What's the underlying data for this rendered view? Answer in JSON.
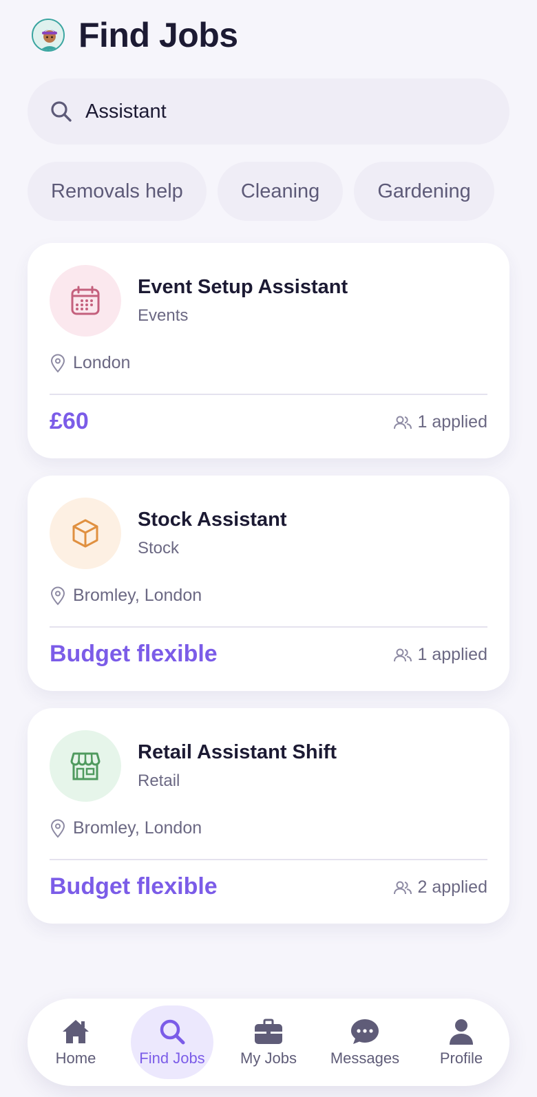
{
  "header": {
    "title": "Find Jobs",
    "avatar_icon": "avatar-icon"
  },
  "search": {
    "value": "Assistant",
    "icon": "search-icon"
  },
  "filters": {
    "chips": [
      "Removals help",
      "Cleaning",
      "Gardening"
    ]
  },
  "jobs": [
    {
      "title": "Event Setup Assistant",
      "category": "Events",
      "location": "London",
      "budget": "£60",
      "applied": "1 applied",
      "icon": "calendar-icon",
      "icon_color": "#c4607d",
      "icon_bg": "#fbe8ee"
    },
    {
      "title": "Stock Assistant",
      "category": "Stock",
      "location": "Bromley, London",
      "budget": "Budget flexible",
      "applied": "1 applied",
      "icon": "box-icon",
      "icon_color": "#e09040",
      "icon_bg": "#fdf0e3"
    },
    {
      "title": "Retail Assistant Shift",
      "category": "Retail",
      "location": "Bromley, London",
      "budget": "Budget flexible",
      "applied": "2 applied",
      "icon": "store-icon",
      "icon_color": "#4f9a5e",
      "icon_bg": "#e6f5ea"
    }
  ],
  "nav": {
    "items": [
      {
        "label": "Home",
        "icon": "home-icon",
        "active": false
      },
      {
        "label": "Find Jobs",
        "icon": "search-icon",
        "active": true
      },
      {
        "label": "My Jobs",
        "icon": "briefcase-icon",
        "active": false
      },
      {
        "label": "Messages",
        "icon": "chat-icon",
        "active": false
      },
      {
        "label": "Profile",
        "icon": "user-icon",
        "active": false
      }
    ]
  },
  "colors": {
    "accent": "#7b5ce8",
    "background": "#f6f5fb",
    "card": "#ffffff",
    "muted_text": "#6b6883",
    "heading_text": "#1c1a33"
  }
}
